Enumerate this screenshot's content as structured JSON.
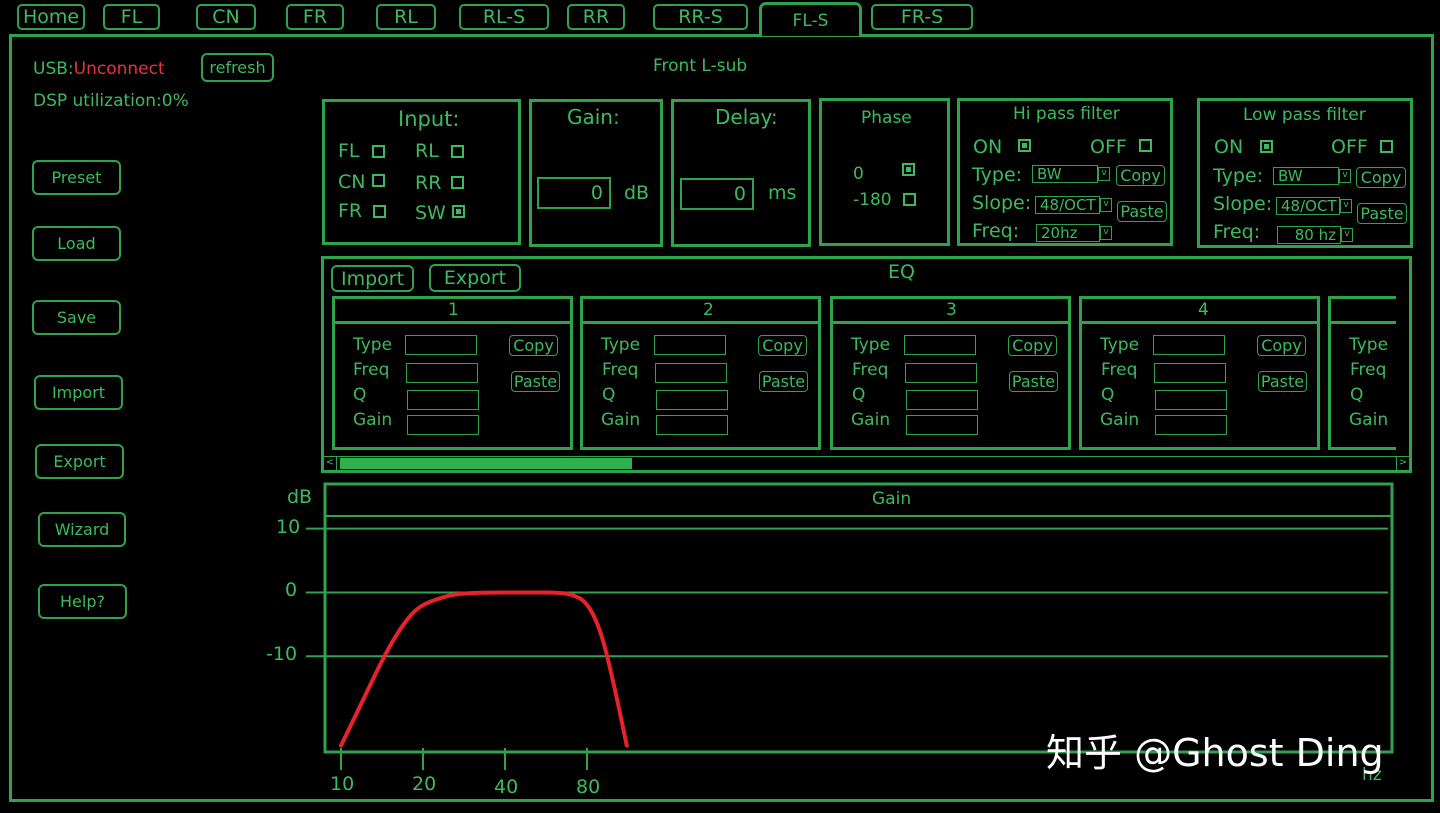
{
  "tabs": [
    {
      "label": "Home"
    },
    {
      "label": "FL"
    },
    {
      "label": "CN"
    },
    {
      "label": "FR"
    },
    {
      "label": "RL"
    },
    {
      "label": "RL-S"
    },
    {
      "label": "RR"
    },
    {
      "label": "RR-S"
    },
    {
      "label": "FL-S"
    },
    {
      "label": "FR-S"
    }
  ],
  "status": {
    "usb_label": "USB:",
    "usb_value": "Unconnect",
    "usb_color": "#e8333a",
    "refresh_label": "refresh",
    "dsp_label": "DSP utilization:0%"
  },
  "channel_title": "Front L-sub",
  "sidebar": {
    "buttons": [
      "Preset",
      "Load",
      "Save",
      "Import",
      "Export",
      "Wizard",
      "Help?"
    ]
  },
  "input_panel": {
    "title": "Input:",
    "channels": [
      {
        "label": "FL",
        "checked": false
      },
      {
        "label": "RL",
        "checked": false
      },
      {
        "label": "CN",
        "checked": false
      },
      {
        "label": "RR",
        "checked": false
      },
      {
        "label": "FR",
        "checked": false
      },
      {
        "label": "SW",
        "checked": true
      }
    ]
  },
  "gain_panel": {
    "title": "Gain:",
    "value": "0",
    "unit": "dB"
  },
  "delay_panel": {
    "title": "Delay:",
    "value": "0",
    "unit": "ms"
  },
  "phase_panel": {
    "title": "Phase",
    "options": [
      {
        "label": "0",
        "checked": true
      },
      {
        "label": "-180",
        "checked": false
      }
    ]
  },
  "hipass": {
    "title": "Hi pass filter",
    "on_label": "ON",
    "off_label": "OFF",
    "on": true,
    "type_label": "Type:",
    "type_value": "BW",
    "slope_label": "Slope:",
    "slope_value": "48/OCT",
    "freq_label": "Freq:",
    "freq_value": "20hz",
    "copy_label": "Copy",
    "paste_label": "Paste"
  },
  "lowpass": {
    "title": "Low pass filter",
    "on_label": "ON",
    "off_label": "OFF",
    "on": true,
    "type_label": "Type:",
    "type_value": "BW",
    "slope_label": "Slope:",
    "slope_value": "48/OCT",
    "freq_label": "Freq:",
    "freq_value": "80 hz",
    "copy_label": "Copy",
    "paste_label": "Paste"
  },
  "eq": {
    "title": "EQ",
    "import_label": "Import",
    "export_label": "Export",
    "field_labels": [
      "Type",
      "Freq",
      "Q",
      "Gain"
    ],
    "copy_label": "Copy",
    "paste_label": "Paste",
    "bands": [
      {
        "number": "1"
      },
      {
        "number": "2"
      },
      {
        "number": "3"
      },
      {
        "number": "4"
      }
    ]
  },
  "chart_data": {
    "type": "line",
    "title": "Gain",
    "ylabel": "dB",
    "xlabel": "hz",
    "y_ticks": [
      10,
      0,
      -10
    ],
    "x_ticks": [
      10,
      20,
      40,
      80
    ],
    "ylim": [
      -25,
      17
    ],
    "series": [
      {
        "color": "#e8222a",
        "x": [
          10,
          12,
          14,
          16,
          18,
          20,
          25,
          30,
          40,
          50,
          60,
          70,
          80,
          90,
          100,
          112
        ],
        "y": [
          -24,
          -17,
          -11,
          -6.5,
          -3.5,
          -1.8,
          -0.4,
          -0.05,
          0,
          0,
          0,
          -0.2,
          -1.5,
          -6,
          -14,
          -24
        ]
      }
    ]
  },
  "watermark": "知乎 @Ghost Ding"
}
